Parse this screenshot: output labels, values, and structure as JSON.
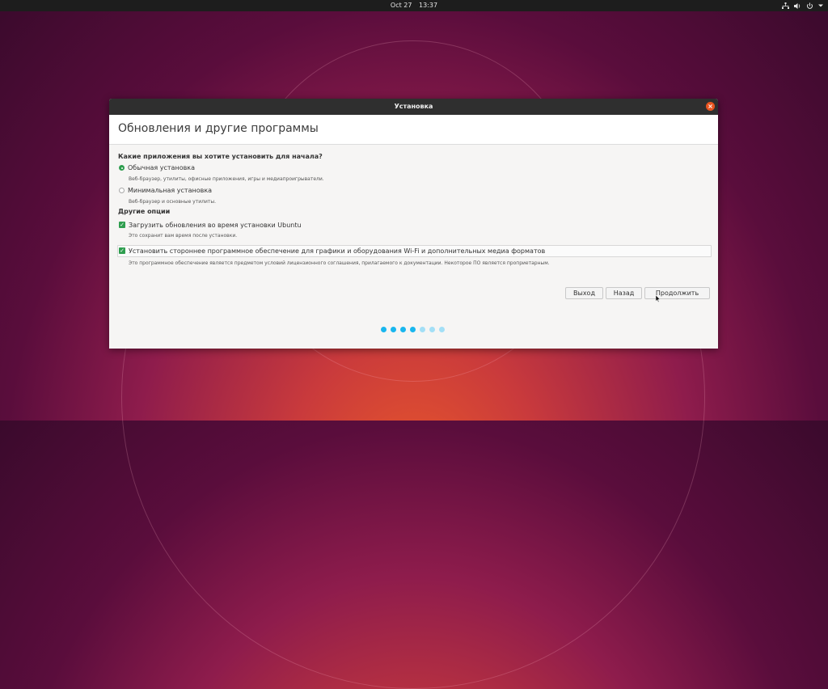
{
  "topbar": {
    "date": "Oct 27",
    "time": "13:37",
    "icons": [
      "network-icon",
      "volume-icon",
      "power-icon",
      "chevron-down-icon"
    ]
  },
  "window": {
    "title": "Установка",
    "close_icon": "close-icon"
  },
  "page": {
    "title": "Обновления и другие программы",
    "question": "Какие приложения вы хотите установить для начала?",
    "options": [
      {
        "label": "Обычная установка",
        "description": "Веб-браузер, утилиты, офисные приложения, игры и медиапроигрыватели.",
        "selected": true
      },
      {
        "label": "Минимальная установка",
        "description": "Веб-браузер и основные утилиты.",
        "selected": false
      }
    ],
    "other_heading": "Другие опции",
    "checkboxes": [
      {
        "label": "Загрузить обновления во время установки Ubuntu",
        "description": "Это сохранит вам время после установки.",
        "checked": true
      },
      {
        "label": "Установить стороннее программное обеспечение для графики и оборудования Wi-Fi и дополнительных медиа форматов",
        "description": "Это программное обеспечение является предметом условий лицензионного соглашения, прилагаемого к документации. Некоторое ПО является проприетарным.",
        "checked": true
      }
    ]
  },
  "buttons": {
    "quit": "Выход",
    "back": "Назад",
    "continue": "Продолжить"
  },
  "progress": {
    "total_steps": 7,
    "completed_steps": 4
  },
  "colors": {
    "accent": "#e95420",
    "check_green": "#2f9e4f",
    "progress_active": "#19b6ee",
    "progress_inactive": "#a3dff6"
  }
}
